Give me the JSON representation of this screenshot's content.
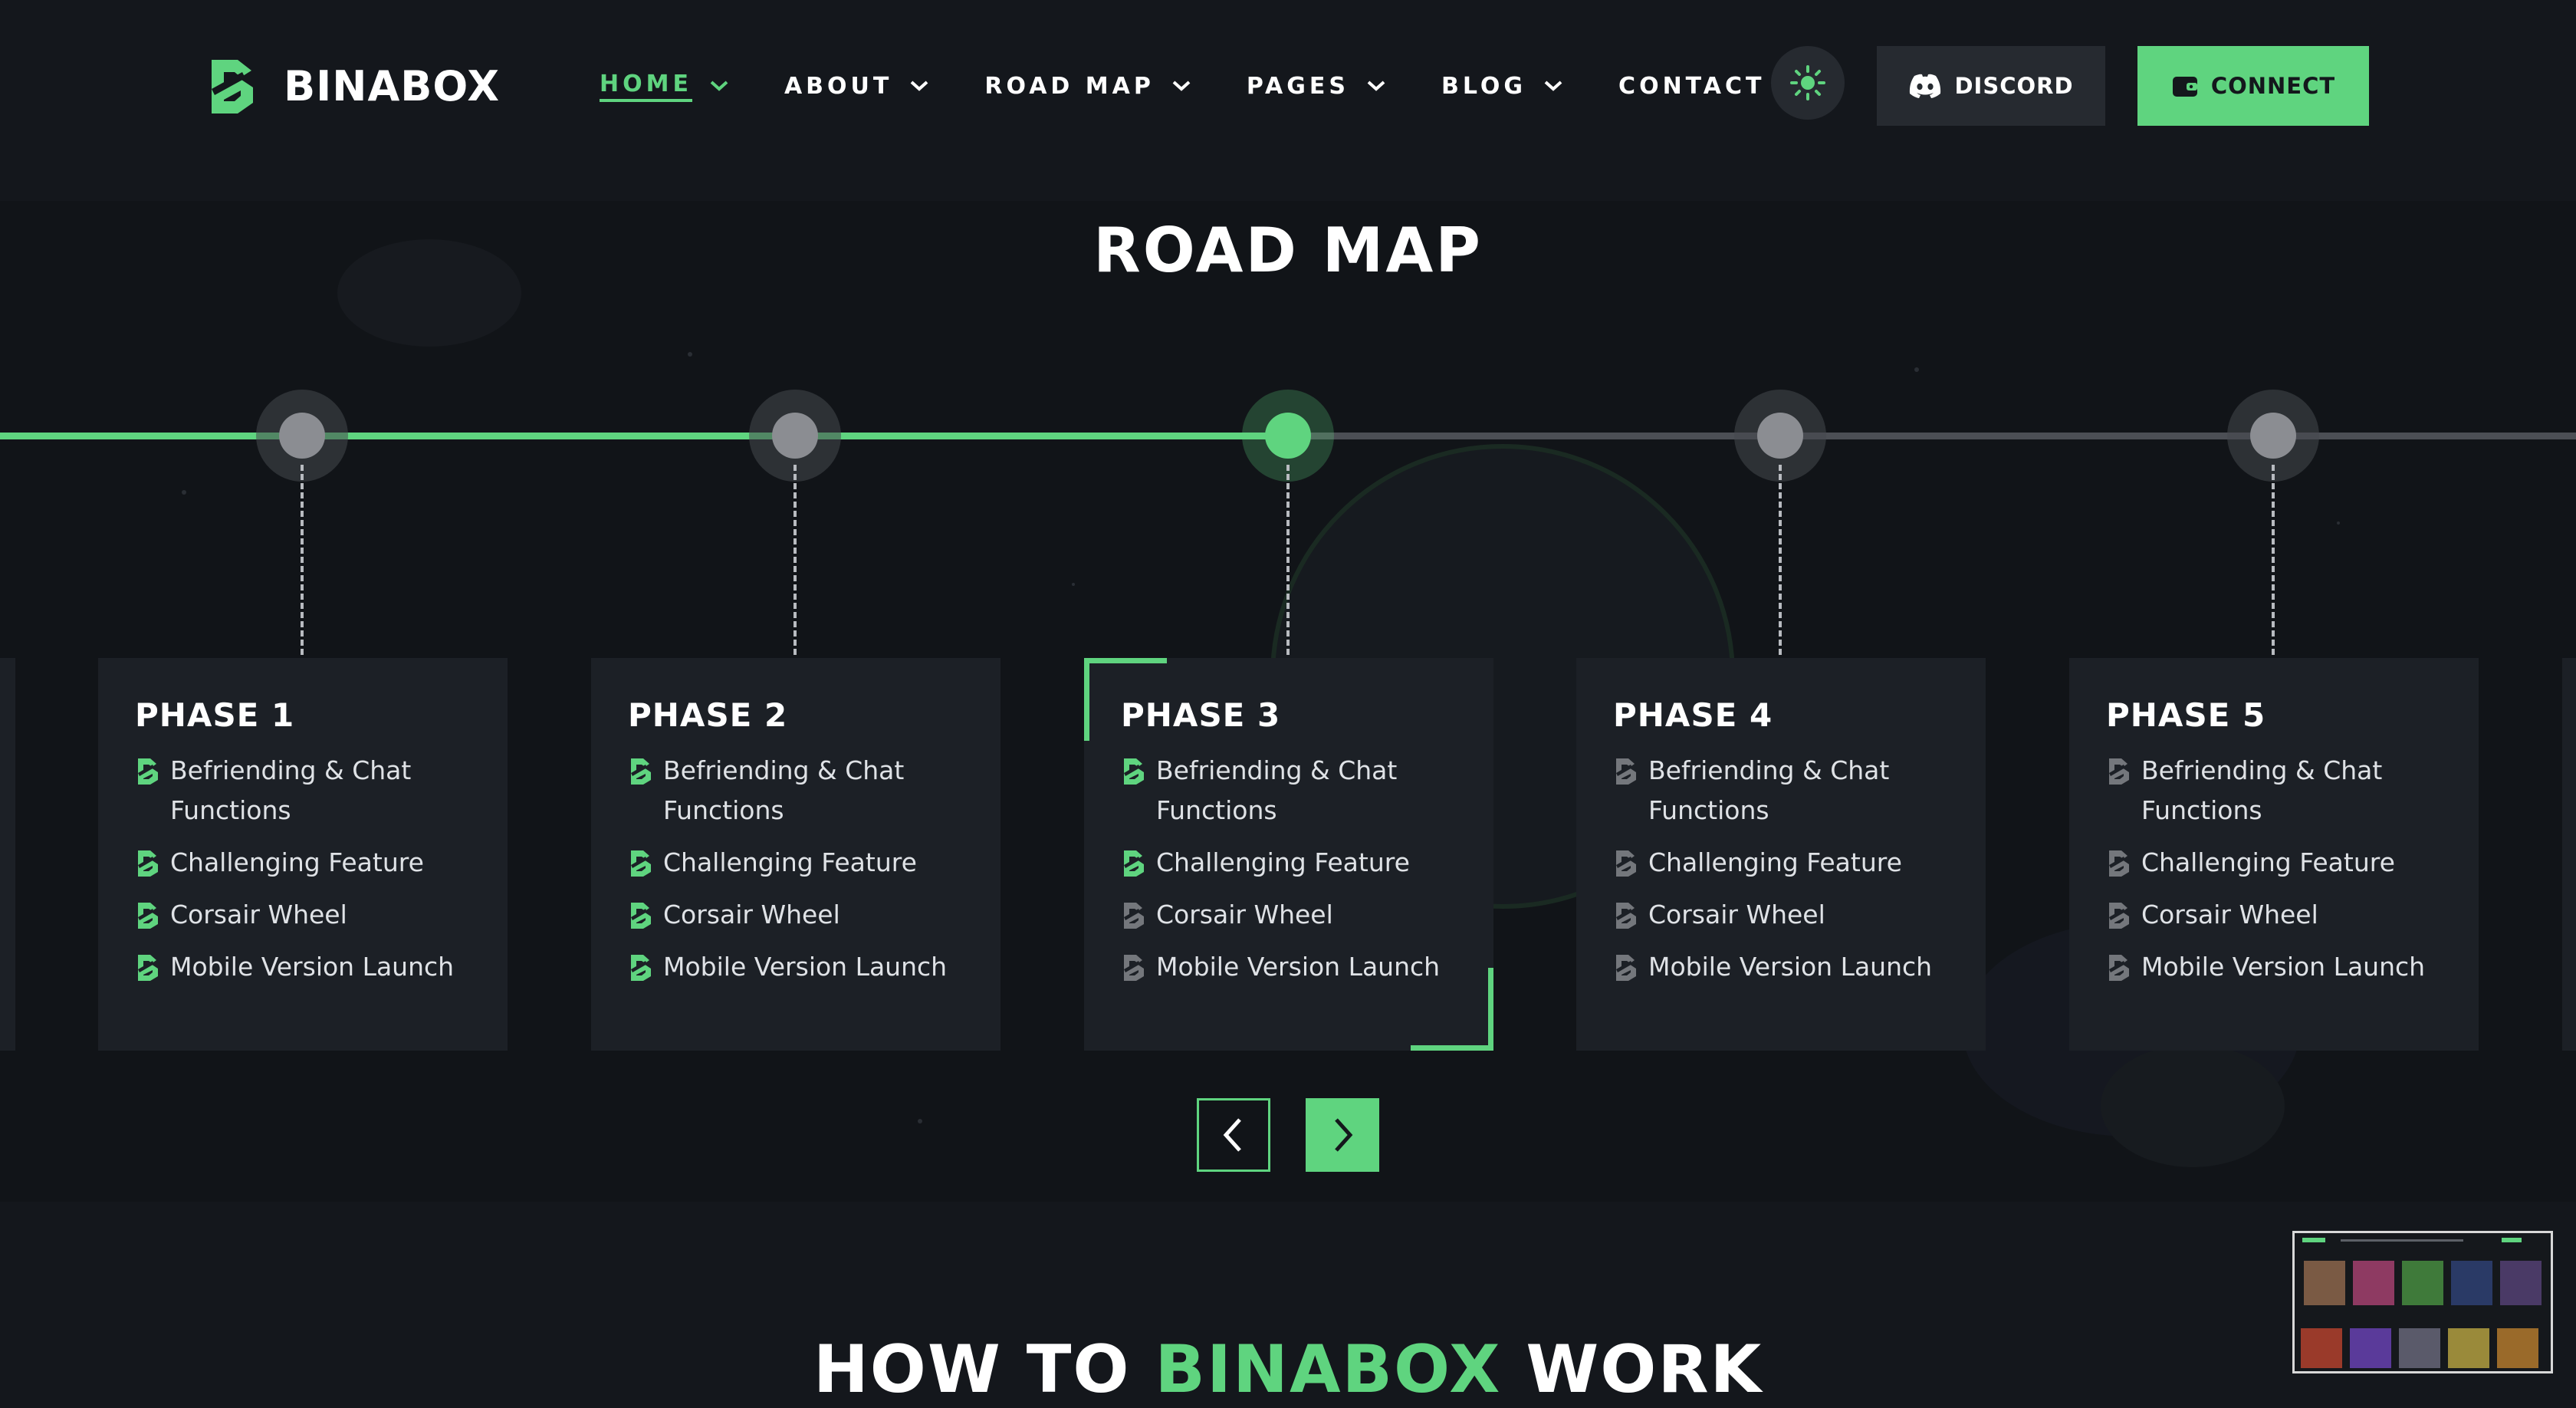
{
  "header": {
    "brand": "BINABOX",
    "nav": [
      {
        "label": "HOME",
        "dropdown": true,
        "active": true
      },
      {
        "label": "ABOUT",
        "dropdown": true
      },
      {
        "label": "ROAD MAP",
        "dropdown": true
      },
      {
        "label": "PAGES",
        "dropdown": true
      },
      {
        "label": "BLOG",
        "dropdown": true
      },
      {
        "label": "CONTACT",
        "dropdown": false
      }
    ],
    "theme_toggle_icon": "sun-icon",
    "discord_label": "DISCORD",
    "connect_label": "CONNECT"
  },
  "roadmap": {
    "title": "ROAD MAP",
    "phases": [
      {
        "title": "PHASE 1",
        "items": [
          "Befriending & Chat Functions",
          "Challenging Feature",
          "Corsair Wheel",
          "Mobile Version Launch"
        ],
        "completed_items": 4
      },
      {
        "title": "PHASE 2",
        "items": [
          "Befriending & Chat Functions",
          "Challenging Feature",
          "Corsair Wheel",
          "Mobile Version Launch"
        ],
        "completed_items": 4
      },
      {
        "title": "PHASE 3",
        "items": [
          "Befriending & Chat Functions",
          "Challenging Feature",
          "Corsair Wheel",
          "Mobile Version Launch"
        ],
        "completed_items": 2
      },
      {
        "title": "PHASE 4",
        "items": [
          "Befriending & Chat Functions",
          "Challenging Feature",
          "Corsair Wheel",
          "Mobile Version Launch"
        ],
        "completed_items": 0
      },
      {
        "title": "PHASE 5",
        "items": [
          "Befriending & Chat Functions",
          "Challenging Feature",
          "Corsair Wheel",
          "Mobile Version Launch"
        ],
        "completed_items": 0
      }
    ],
    "active_phase": 3,
    "prev_icon": "chevron-left-icon",
    "next_icon": "chevron-right-icon"
  },
  "how_section": {
    "title_before": "HOW TO ",
    "title_accent": "BINABOX",
    "title_after": " WORK"
  },
  "colors": {
    "accent": "#5fd47f",
    "background": "#14171c",
    "card": "#1c2026",
    "inactive": "#8b8d92"
  }
}
